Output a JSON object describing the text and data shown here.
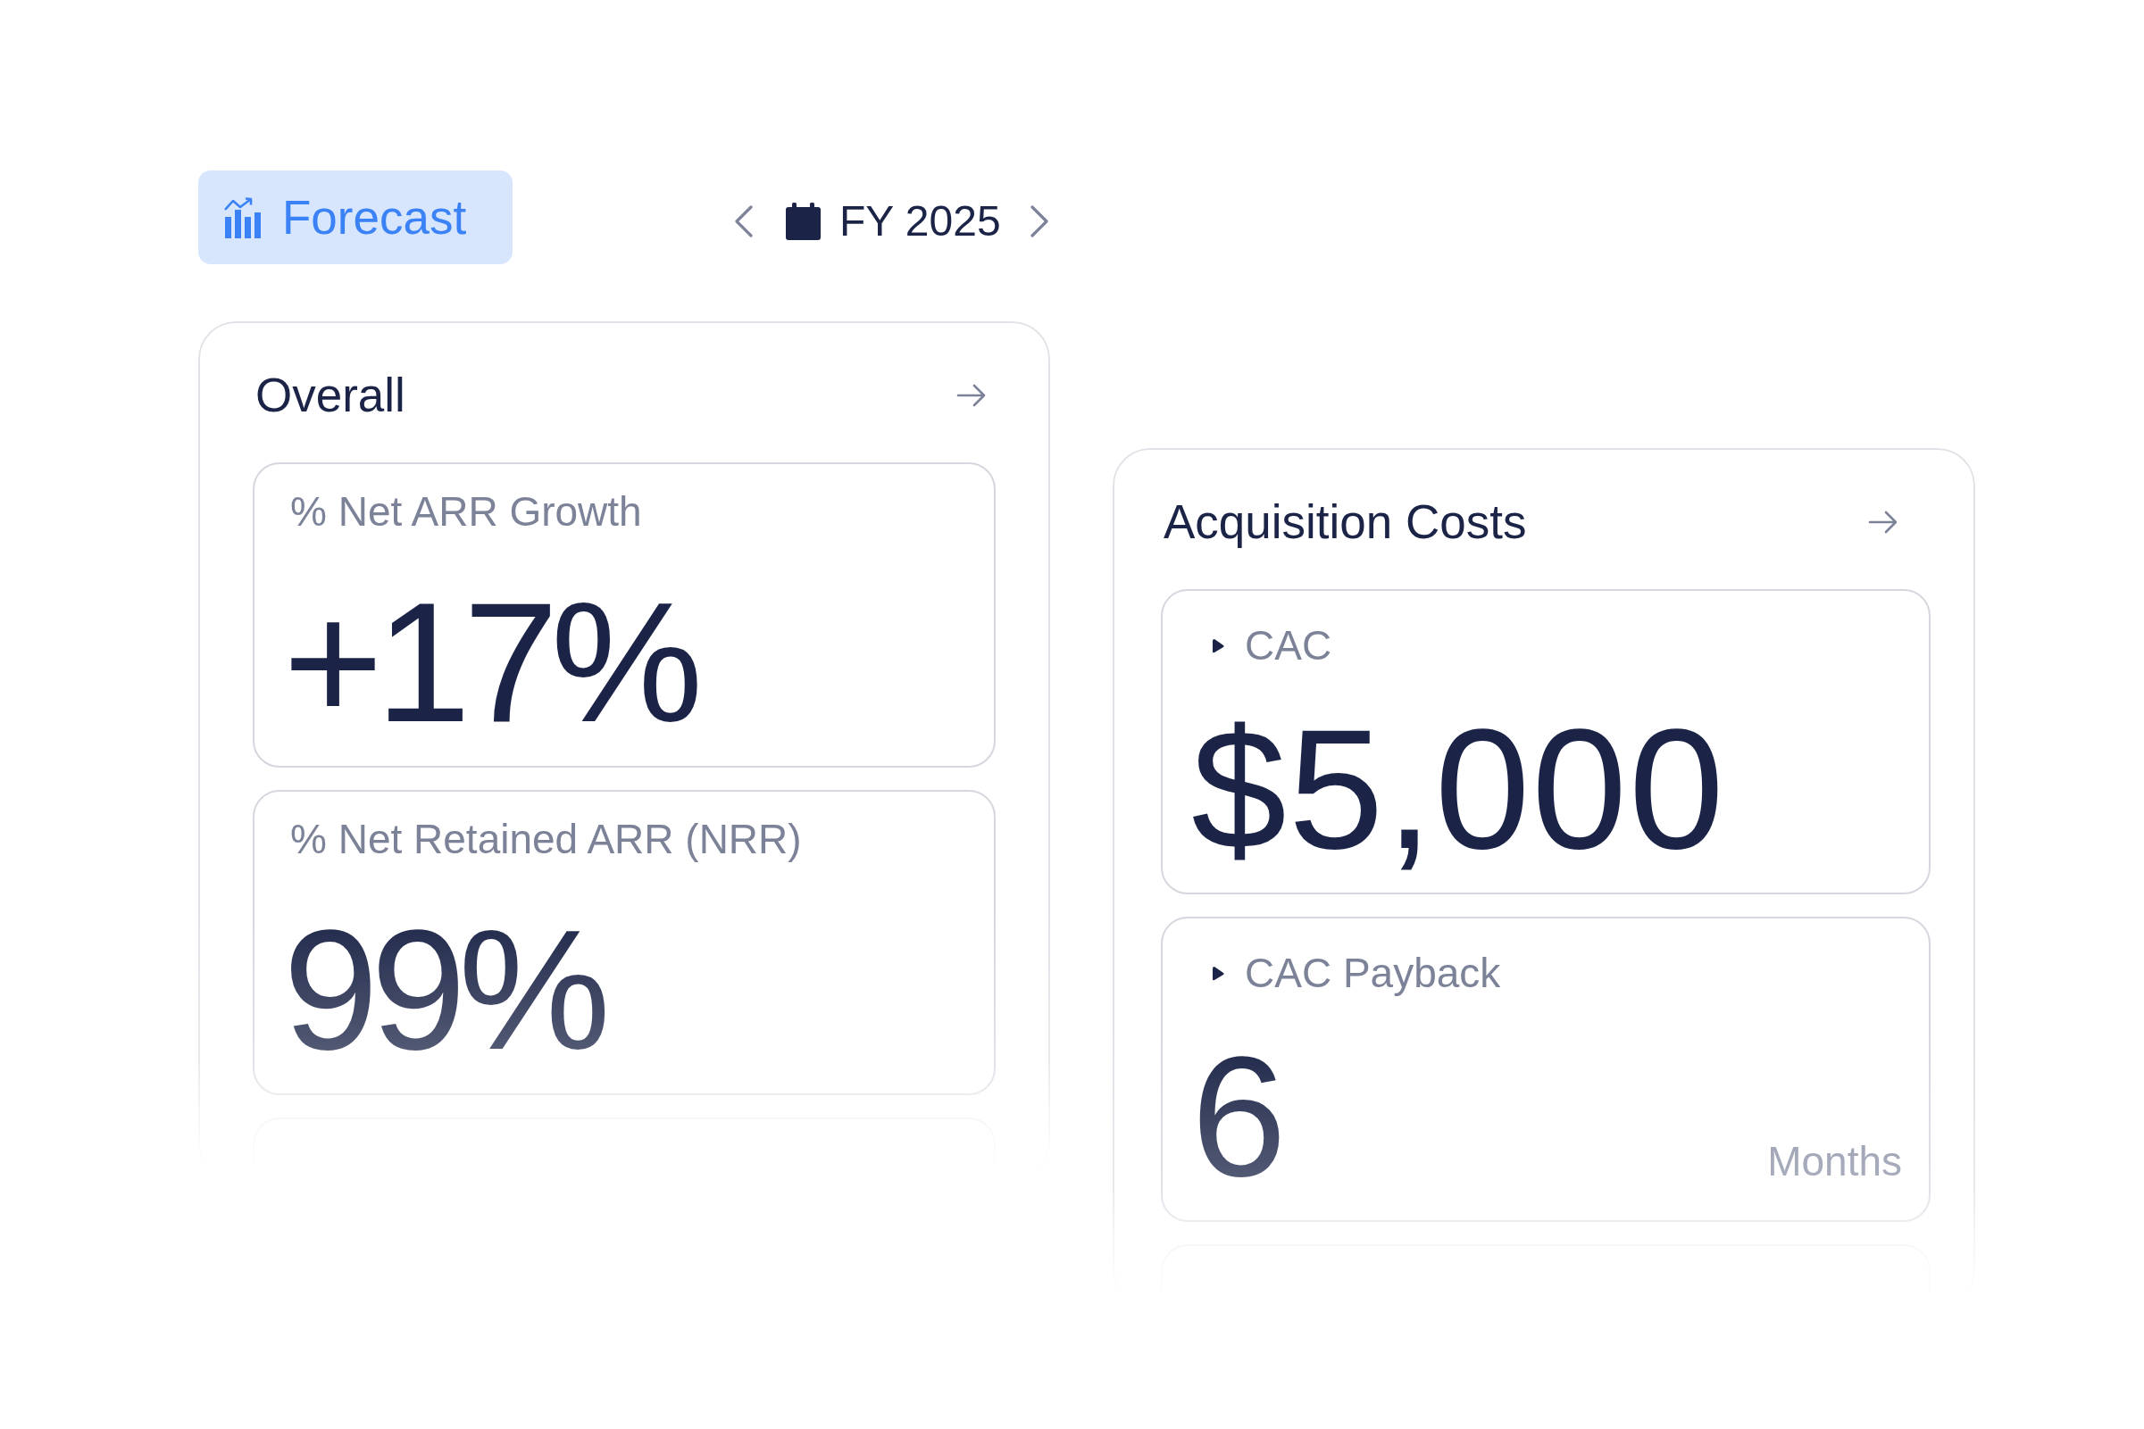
{
  "toolbar": {
    "view_button": {
      "label": "Forecast"
    },
    "period": {
      "label": "FY 2025"
    }
  },
  "panels": [
    {
      "title": "Overall",
      "metrics": [
        {
          "label": "% Net ARR Growth",
          "value": "+17%"
        },
        {
          "label": "% Net Retained ARR (NRR)",
          "value": "99%"
        }
      ]
    },
    {
      "title": "Acquisition Costs",
      "metrics": [
        {
          "label": "CAC",
          "value": "$5,000",
          "expanded": false
        },
        {
          "label": "CAC Payback",
          "value": "6",
          "unit": "Months",
          "expanded": false
        }
      ]
    }
  ]
}
